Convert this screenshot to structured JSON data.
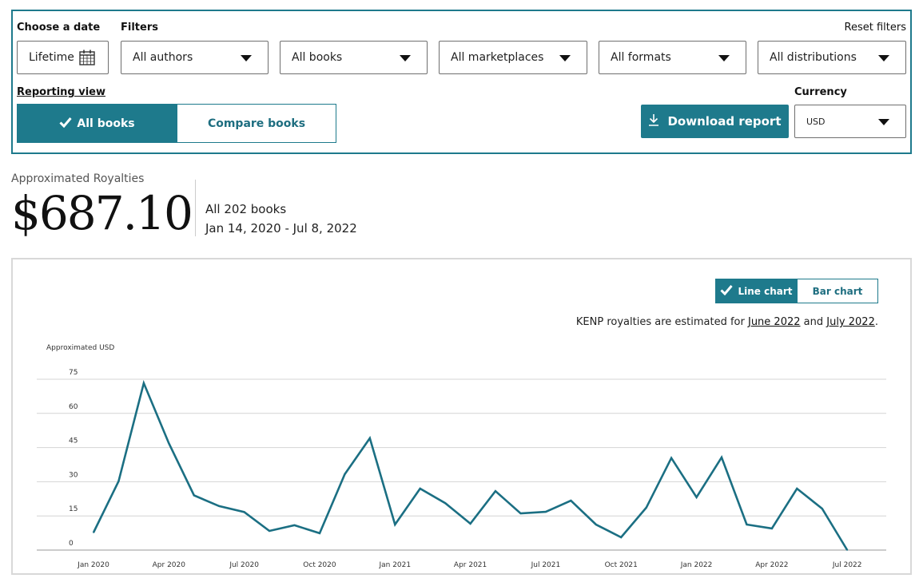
{
  "filters": {
    "date_label": "Choose a date",
    "date_value": "Lifetime",
    "filters_label": "Filters",
    "reset_label": "Reset filters",
    "dropdowns": [
      "All authors",
      "All books",
      "All marketplaces",
      "All formats",
      "All distributions"
    ]
  },
  "reporting": {
    "label": "Reporting view",
    "all_books": "All books",
    "compare_books": "Compare books"
  },
  "download_label": "Download report",
  "currency": {
    "label": "Currency",
    "value": "USD"
  },
  "summary": {
    "label": "Approximated Royalties",
    "value": "$687.10",
    "books": "All 202 books",
    "range": "Jan 14, 2020 - Jul 8, 2022"
  },
  "chart_toggle": {
    "line": "Line chart",
    "bar": "Bar chart"
  },
  "note": {
    "prefix": "KENP royalties are estimated for ",
    "link1": "June 2022",
    "mid": " and ",
    "link2": "July 2022",
    "suffix": "."
  },
  "colors": {
    "accent": "#1e7a8c",
    "line": "#1b6f83"
  },
  "chart_data": {
    "type": "line",
    "ylabel": "Approximated USD",
    "ylim": [
      0,
      75
    ],
    "yticks": [
      0,
      15,
      30,
      45,
      60,
      75
    ],
    "grid": true,
    "x_labels": [
      "Jan 2020",
      "Apr 2020",
      "Jul 2020",
      "Oct 2020",
      "Jan 2021",
      "Apr 2021",
      "Jul 2021",
      "Oct 2021",
      "Jan 2022",
      "Apr 2022",
      "Jul 2022"
    ],
    "x": [
      "Jan 2020",
      "Feb 2020",
      "Mar 2020",
      "Apr 2020",
      "May 2020",
      "Jun 2020",
      "Jul 2020",
      "Aug 2020",
      "Sep 2020",
      "Oct 2020",
      "Nov 2020",
      "Dec 2020",
      "Jan 2021",
      "Feb 2021",
      "Mar 2021",
      "Apr 2021",
      "May 2021",
      "Jun 2021",
      "Jul 2021",
      "Aug 2021",
      "Sep 2021",
      "Oct 2021",
      "Nov 2021",
      "Dec 2021",
      "Jan 2022",
      "Feb 2022",
      "Mar 2022",
      "Apr 2022",
      "May 2022",
      "Jun 2022",
      "Jul 2022"
    ],
    "series": [
      {
        "values": [
          7.7,
          30.2,
          73.3,
          46.9,
          24.0,
          19.3,
          16.7,
          8.4,
          10.9,
          7.4,
          33.3,
          49.1,
          11.2,
          27.0,
          20.6,
          11.6,
          25.9,
          16.1,
          16.8,
          21.7,
          11.2,
          5.6,
          18.6,
          40.4,
          23.2,
          40.7,
          11.2,
          9.5,
          27.0,
          18.2,
          0.0
        ]
      }
    ]
  }
}
